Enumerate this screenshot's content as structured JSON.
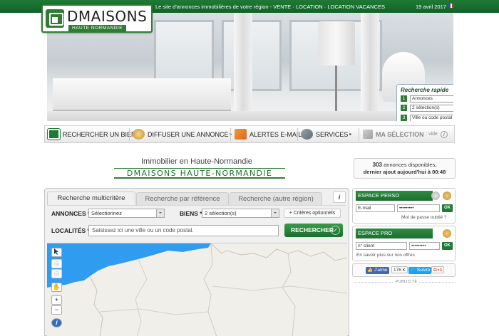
{
  "topbar": {
    "tagline": "Le site d'annonces immobilières de votre région - VENTE · LOCATION · LOCATION VACANCES",
    "date": "19 avril 2017"
  },
  "logo": {
    "name": "DMAISONS",
    "sub": "HAUTE NORMANDIE"
  },
  "quick_search": {
    "title": "Recherche rapide",
    "fields": [
      {
        "num": "1",
        "value": "Annonces"
      },
      {
        "num": "2",
        "value": "2 sélection(s)"
      },
      {
        "num": "3",
        "value": "Ville ou code postal"
      }
    ],
    "ok_label": "OK"
  },
  "nav": {
    "items": [
      {
        "label": "RECHERCHER UN BIEN",
        "icon": "house-icon"
      },
      {
        "label": "DIFFUSER UNE ANNONCE",
        "icon": "megaphone-icon"
      },
      {
        "label": "ALERTES E-MAIL",
        "icon": "email-alert-icon"
      },
      {
        "label": "SERVICES",
        "icon": "services-icon"
      }
    ],
    "selection_label": "MA SÉLECTION",
    "selection_count": ": vide"
  },
  "heading": "Immobilier en Haute-Normandie",
  "brand_line": "DMAISONS HAUTE-NORMANDIE",
  "announce": {
    "count": "303",
    "count_suffix": "annonces disponibles,",
    "last_added": "dernier ajout aujourd'hui à 00:48"
  },
  "search": {
    "tabs": [
      "Recherche multicritère",
      "Recherche par référence",
      "Recherche (autre région)"
    ],
    "annonces_label": "ANNONCES *",
    "annonces_value": "Sélectionnez",
    "biens_label": "BIENS *",
    "biens_value": "2 sélection(s)",
    "criteria_label": "+ Critères optionnels",
    "localites_label": "LOCALITÉS *",
    "localites_placeholder": "Saisissez ici une ville ou un code postal.",
    "button_label": "RECHERCHER"
  },
  "map_controls": {
    "zoom_in": "+",
    "zoom_out": "−",
    "info": "i"
  },
  "espace_perso": {
    "title": "ESPACE PERSO",
    "email_placeholder": "E-mail",
    "password_value": "•••••••••",
    "ok_label": "OK",
    "link": "Mot de passe oublié ?"
  },
  "espace_pro": {
    "title": "ESPACE PRO",
    "client_placeholder": "n° client",
    "password_value": "•••••••••",
    "ok_label": "OK",
    "link": "En savoir plus sur nos offres"
  },
  "social": {
    "like_label": "J'aime",
    "like_count": "176 K",
    "follow_label": "Suivre",
    "gplus_label": "G+1"
  },
  "pub_label": "PUBLICITÉ",
  "colors": {
    "brand_green": "#1f7a34",
    "sea_blue": "#2f9cf0"
  }
}
